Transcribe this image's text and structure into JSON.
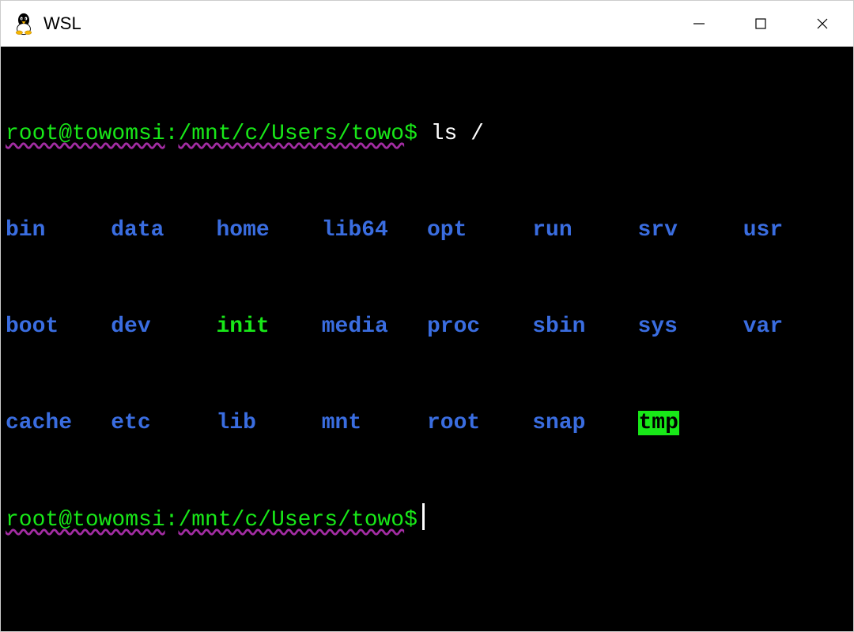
{
  "window": {
    "title": "WSL"
  },
  "terminal": {
    "prompt": {
      "userhost": "root@towomsi",
      "colon": ":",
      "path": "/mnt/c/Users/towo",
      "sigil": "$"
    },
    "command": "ls /",
    "listing": {
      "columns": [
        [
          {
            "name": "bin",
            "kind": "dir"
          },
          {
            "name": "boot",
            "kind": "dir"
          },
          {
            "name": "cache",
            "kind": "dir"
          }
        ],
        [
          {
            "name": "data",
            "kind": "dir"
          },
          {
            "name": "dev",
            "kind": "dir"
          },
          {
            "name": "etc",
            "kind": "dir"
          }
        ],
        [
          {
            "name": "home",
            "kind": "dir"
          },
          {
            "name": "init",
            "kind": "exe"
          },
          {
            "name": "lib",
            "kind": "dir"
          }
        ],
        [
          {
            "name": "lib64",
            "kind": "dir"
          },
          {
            "name": "media",
            "kind": "dir"
          },
          {
            "name": "mnt",
            "kind": "dir"
          }
        ],
        [
          {
            "name": "opt",
            "kind": "dir"
          },
          {
            "name": "proc",
            "kind": "dir"
          },
          {
            "name": "root",
            "kind": "dir"
          }
        ],
        [
          {
            "name": "run",
            "kind": "dir"
          },
          {
            "name": "sbin",
            "kind": "dir"
          },
          {
            "name": "snap",
            "kind": "dir"
          }
        ],
        [
          {
            "name": "srv",
            "kind": "dir"
          },
          {
            "name": "sys",
            "kind": "dir"
          },
          {
            "name": "tmp",
            "kind": "sticky"
          }
        ],
        [
          {
            "name": "usr",
            "kind": "dir"
          },
          {
            "name": "var",
            "kind": "dir"
          }
        ]
      ]
    }
  }
}
